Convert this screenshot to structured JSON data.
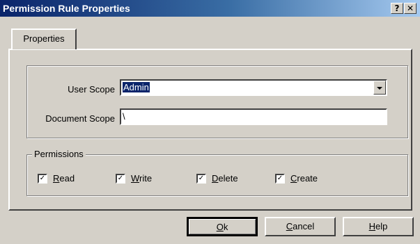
{
  "window": {
    "title": "Permission Rule Properties",
    "help_glyph": "?",
    "close_glyph": "✕"
  },
  "tabs": [
    {
      "label": "Properties",
      "active": true
    }
  ],
  "scope": {
    "user_scope_label": "User Scope",
    "user_scope_value": "Admin",
    "document_scope_label": "Document Scope",
    "document_scope_value": "\\"
  },
  "permissions": {
    "group_label": "Permissions",
    "items": [
      {
        "key": "R",
        "rest": "ead",
        "checked": true
      },
      {
        "key": "W",
        "rest": "rite",
        "checked": true
      },
      {
        "key": "D",
        "rest": "elete",
        "checked": true
      },
      {
        "key": "C",
        "rest": "reate",
        "checked": true
      }
    ],
    "check_glyph": "✓"
  },
  "buttons": {
    "ok": {
      "key": "O",
      "rest": "k"
    },
    "cancel": {
      "key": "C",
      "rest": "ancel"
    },
    "help": {
      "key": "H",
      "rest": "elp"
    }
  }
}
